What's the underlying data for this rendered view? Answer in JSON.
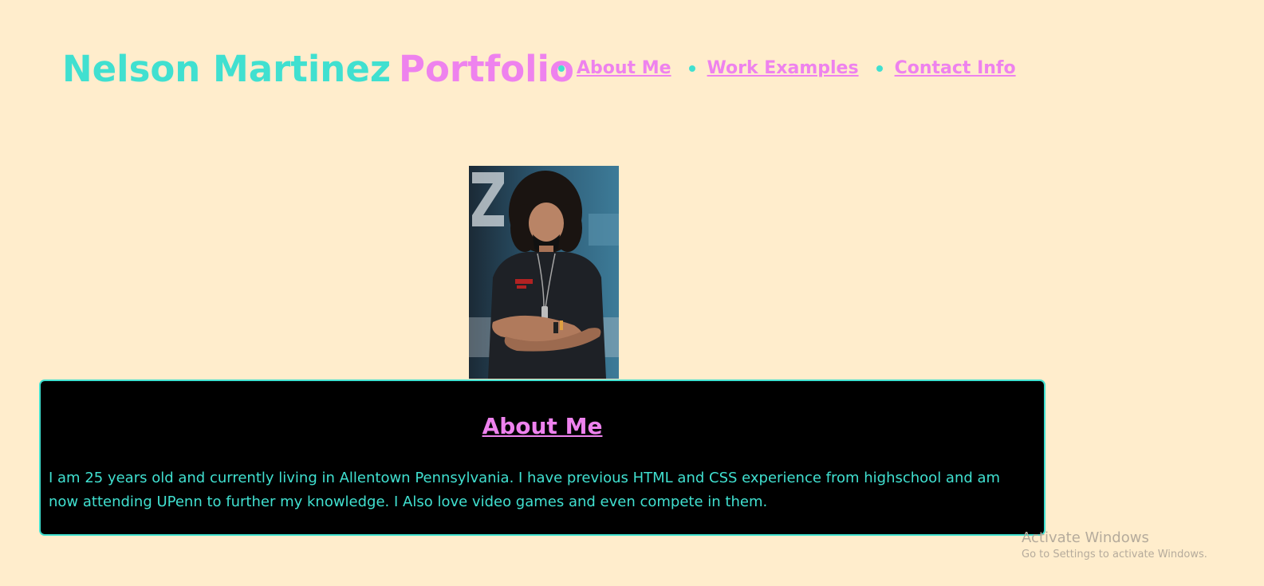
{
  "header": {
    "name": "Nelson Martinez",
    "portfolio": "Portfolio"
  },
  "nav": {
    "items": [
      {
        "label": "About Me"
      },
      {
        "label": "Work Examples"
      },
      {
        "label": "Contact Info"
      }
    ]
  },
  "about": {
    "heading": "About Me",
    "text": "I am 25 years old and currently living in Allentown Pennsylvania. I have previous HTML and CSS experience from highschool and am now attending UPenn to further my knowledge. I Also love video games and even compete in them."
  },
  "watermark": {
    "title": "Activate Windows",
    "subtitle": "Go to Settings to activate Windows."
  },
  "colors": {
    "background": "#ffedcc",
    "accent_teal": "#40e0d0",
    "accent_pink": "#ee82ee",
    "card_bg": "#000000"
  }
}
